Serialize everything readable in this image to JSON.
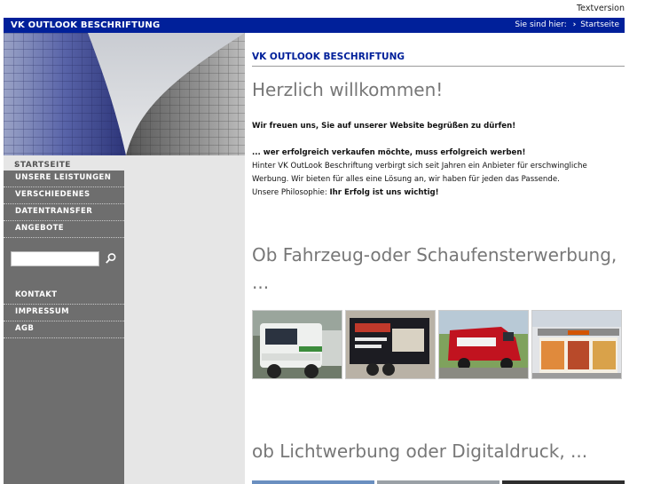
{
  "top": {
    "textversion": "Textversion"
  },
  "header": {
    "brand": "VK OUTLOOK BESCHRIFTUNG",
    "breadcrumb_prefix": "Sie sind hier:",
    "breadcrumb_arrow": "›",
    "breadcrumb_current": "Startseite"
  },
  "nav": {
    "current": "STARTSEITE",
    "current_arrow": "›",
    "items": [
      "UNSERE LEISTUNGEN",
      "VERSCHIEDENES",
      "DATENTRANSFER",
      "ANGEBOTE"
    ],
    "items2": [
      "KONTAKT",
      "IMPRESSUM",
      "AGB"
    ]
  },
  "search": {
    "value": "",
    "placeholder": ""
  },
  "main": {
    "section_title": "VK OUTLOOK BESCHRIFTUNG",
    "heading": "Herzlich willkommen!",
    "welcome": "Wir freuen uns, Sie auf unserer Website begrüßen zu dürfen!",
    "slogan": "... wer erfolgreich verkaufen möchte, muss erfolgreich werben!",
    "para_line1": "Hinter VK OutLook Beschriftung verbirgt sich seit Jahren ein Anbieter für erschwingliche",
    "para_line2": "Werbung. Wir bieten für alles eine Lösung an, wir haben für jeden das Passende.",
    "philosophy_prefix": "Unsere Philosophie: ",
    "philosophy_bold": "Ihr Erfolg ist uns wichtig!",
    "heading2": "Ob Fahrzeug-oder Schaufensterwerbung, ...",
    "heading3": "ob Lichtwerbung oder Digitaldruck, ..."
  },
  "icons": {
    "search": "search-icon",
    "breadcrumb": "chevron-right-icon"
  },
  "colors": {
    "brand_blue": "#00209a",
    "nav_dark": "#6e6e6e",
    "nav_light": "#e6e6e6",
    "heading_gray": "#777777"
  }
}
